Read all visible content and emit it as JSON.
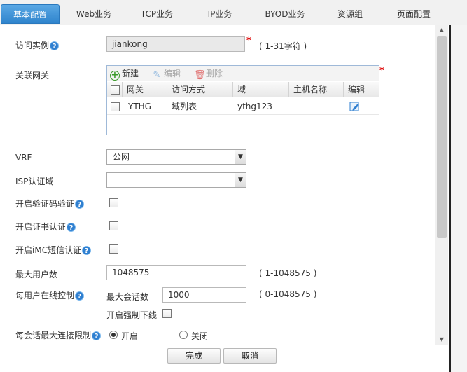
{
  "tabs": [
    {
      "label": "基本配置",
      "active": true
    },
    {
      "label": "Web业务"
    },
    {
      "label": "TCP业务"
    },
    {
      "label": "IP业务"
    },
    {
      "label": "BYOD业务"
    },
    {
      "label": "资源组"
    },
    {
      "label": "页面配置"
    }
  ],
  "form": {
    "instance": {
      "label": "访问实例",
      "value": "jiankong",
      "required": "*",
      "hint": "( 1-31字符 )"
    },
    "gateway": {
      "label": "关联网关",
      "required": "*",
      "toolbar": {
        "new": "新建",
        "edit": "编辑",
        "delete": "删除"
      },
      "columns": [
        "网关",
        "访问方式",
        "域",
        "主机名称",
        "编辑"
      ],
      "rows": [
        {
          "gateway": "YTHG",
          "method": "域列表",
          "domain": "ythg123",
          "host": ""
        }
      ]
    },
    "vrf": {
      "label": "VRF",
      "value": "公网"
    },
    "isp": {
      "label": "ISP认证域",
      "value": ""
    },
    "captcha": {
      "label": "开启验证码验证"
    },
    "cert": {
      "label": "开启证书认证"
    },
    "imc": {
      "label": "开启iMC短信认证"
    },
    "max_users": {
      "label": "最大用户数",
      "value": "1048575",
      "hint": "( 1-1048575 )"
    },
    "online": {
      "label": "每用户在线控制",
      "max_sessions_label": "最大会话数",
      "max_sessions_value": "1000",
      "hint": "( 0-1048575 )",
      "force_offline_label": "开启强制下线"
    },
    "conn_limit": {
      "label": "每会话最大连接限制",
      "on": "开启",
      "off": "关闭"
    }
  },
  "buttons": {
    "ok": "完成",
    "cancel": "取消"
  },
  "colors": {
    "tab_active": "#3a8fd6",
    "required": "#dd0000",
    "help": "#2f7fd0"
  }
}
